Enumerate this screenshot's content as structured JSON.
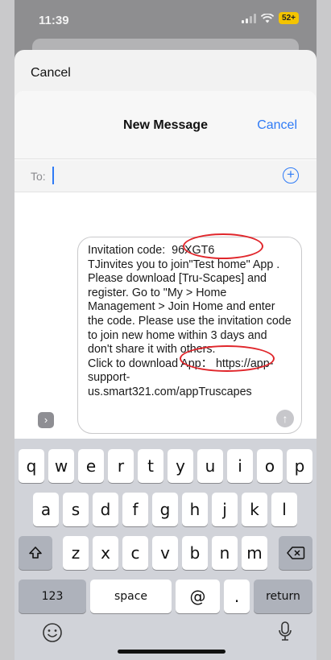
{
  "status_bar": {
    "time": "11:39",
    "battery": "52+"
  },
  "background_sheet": {
    "cancel_label": "Cancel"
  },
  "compose": {
    "title": "New Message",
    "cancel_label": "Cancel",
    "to_label": "To:",
    "message": "Invitation code:  96XGT6\nTJinvites you to join\"Test home\" App . Please download [Tru-Scapes] and register. Go to \"My > Home Management > Join Home and enter the code. Please use the invitation code to join new home within 3 days and don't share it with others.\nClick to download App： https://app-support-us.smart321.com/appTruscapes"
  },
  "keyboard": {
    "row1": [
      "q",
      "w",
      "e",
      "r",
      "t",
      "y",
      "u",
      "i",
      "o",
      "p"
    ],
    "row2": [
      "a",
      "s",
      "d",
      "f",
      "g",
      "h",
      "j",
      "k",
      "l"
    ],
    "row3": [
      "z",
      "x",
      "c",
      "v",
      "b",
      "n",
      "m"
    ],
    "numbers_label": "123",
    "space_label": "space",
    "at_label": "@",
    "period_label": ".",
    "return_label": "return"
  },
  "colors": {
    "accent": "#2f7bf6",
    "highlight": "#e0262b"
  },
  "icons": {
    "shift": "shift-icon",
    "delete": "backspace-icon",
    "emoji": "emoji-icon",
    "mic": "microphone-icon",
    "apps": "chevron-right-icon",
    "send": "send-arrow-icon",
    "add": "add-contact-icon"
  }
}
